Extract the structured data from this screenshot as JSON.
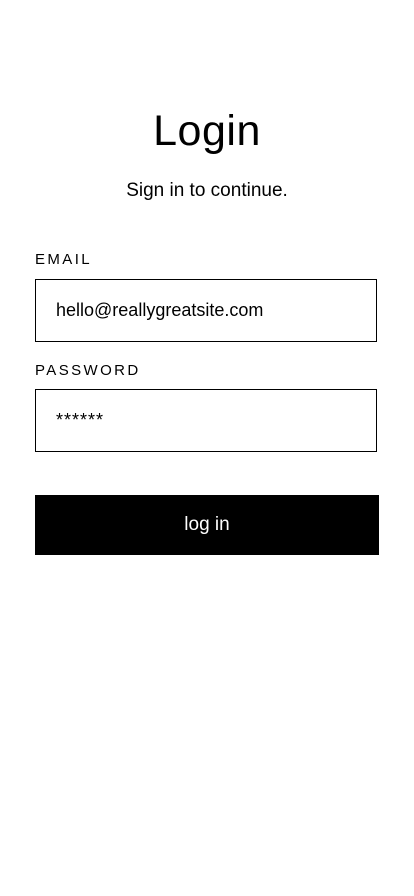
{
  "login": {
    "title": "Login",
    "subtitle": "Sign in to continue.",
    "email_label": "EMAIL",
    "email_value": "hello@reallygreatsite.com",
    "password_label": "PASSWORD",
    "password_value": "******",
    "button_label": "log in"
  },
  "colors": {
    "background": "#ffffff",
    "text": "#000000",
    "button_bg": "#000000",
    "button_text": "#ffffff"
  }
}
